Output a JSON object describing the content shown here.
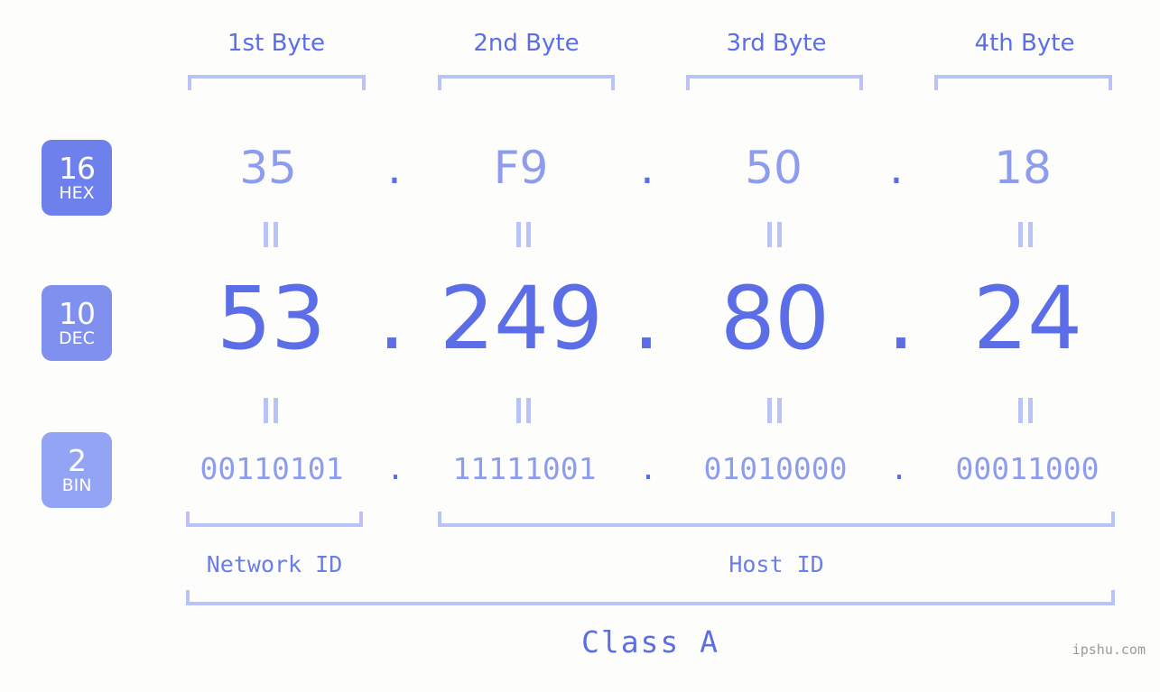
{
  "background_color": "#fdfefb",
  "colors": {
    "accent_strong": "#5b6ee8",
    "accent_light": "#8e9cf0",
    "bracket": "#b9c2f9",
    "badge_hex": "#6d80ec",
    "badge_dec": "#7f90ef",
    "badge_bin": "#93a4f4",
    "watermark": "#9a9a9a"
  },
  "header": {
    "byte_labels": [
      "1st Byte",
      "2nd Byte",
      "3rd Byte",
      "4th Byte"
    ]
  },
  "bases": [
    {
      "number": "16",
      "name": "HEX"
    },
    {
      "number": "10",
      "name": "DEC"
    },
    {
      "number": "2",
      "name": "BIN"
    }
  ],
  "separator": ".",
  "rows": {
    "hex": {
      "base_number": "16",
      "base_name": "HEX",
      "values": [
        "35",
        "F9",
        "50",
        "18"
      ]
    },
    "dec": {
      "base_number": "10",
      "base_name": "DEC",
      "values": [
        "53",
        "249",
        "80",
        "24"
      ]
    },
    "bin": {
      "base_number": "2",
      "base_name": "BIN",
      "values": [
        "00110101",
        "11111001",
        "01010000",
        "00011000"
      ]
    }
  },
  "footer": {
    "network_id_label": "Network ID",
    "host_id_label": "Host ID",
    "class_label": "Class A"
  },
  "watermark": "ipshu.com"
}
